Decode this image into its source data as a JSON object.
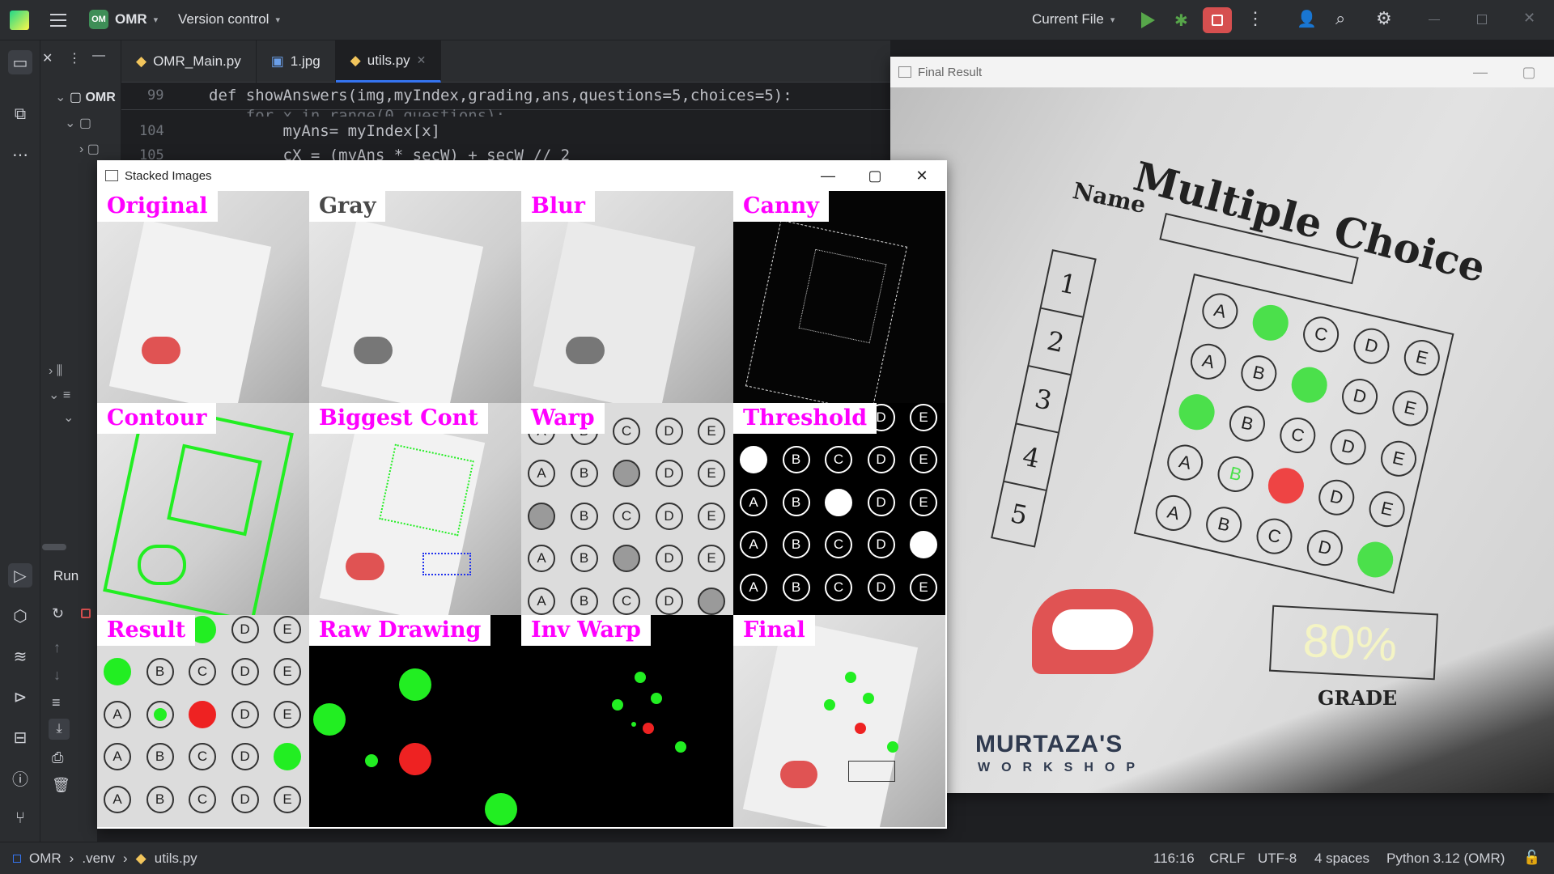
{
  "titlebar": {
    "project_badge": "OM",
    "project_name": "OMR",
    "vcs_label": "Version control",
    "run_config": "Current File"
  },
  "tabs": [
    {
      "label": "OMR_Main.py",
      "icon": "python-file-icon"
    },
    {
      "label": "1.jpg",
      "icon": "image-file-icon"
    },
    {
      "label": "utils.py",
      "icon": "python-file-icon",
      "active": true
    }
  ],
  "editor": {
    "sticky_line_number": "99",
    "sticky_code": "def showAnswers(img,myIndex,grading,ans,questions=5,choices=5):",
    "lines": [
      {
        "n": "104",
        "code": "        myAns= myIndex[x]"
      },
      {
        "n": "105",
        "code": "        cX = (myAns * secW) + secW // 2"
      }
    ],
    "partial_line": "    for x in range(0,questions):"
  },
  "project_tree": {
    "root": "OMR"
  },
  "run_panel": {
    "title": "Run"
  },
  "stacked_window": {
    "title": "Stacked Images",
    "labels": [
      "Original",
      "Gray",
      "Blur",
      "Canny",
      "Contour",
      "Biggest Cont",
      "Warp",
      "Threshold",
      "Result",
      "Raw Drawing",
      "Inv Warp",
      "Final"
    ],
    "grid_letters": [
      "A",
      "B",
      "C",
      "D",
      "E"
    ]
  },
  "final_window": {
    "title": "Final Result",
    "sheet_title": "Multiple Choice",
    "name_label": "Name",
    "question_numbers": [
      "1",
      "2",
      "3",
      "4",
      "5"
    ],
    "grade_value": "80%",
    "grade_label": "GRADE",
    "brand_name": "MURTAZA'S",
    "brand_sub": "WORKSHOP"
  },
  "status": {
    "breadcrumb": [
      "OMR",
      ".venv",
      "utils.py"
    ],
    "position": "116:16",
    "line_sep": "CRLF",
    "encoding": "UTF-8",
    "indent": "4 spaces",
    "interpreter": "Python 3.12 (OMR)"
  },
  "colors": {
    "correct": "#22ee22",
    "wrong": "#ee2222",
    "label": "#ff00ff",
    "accent": "#3574f0"
  }
}
